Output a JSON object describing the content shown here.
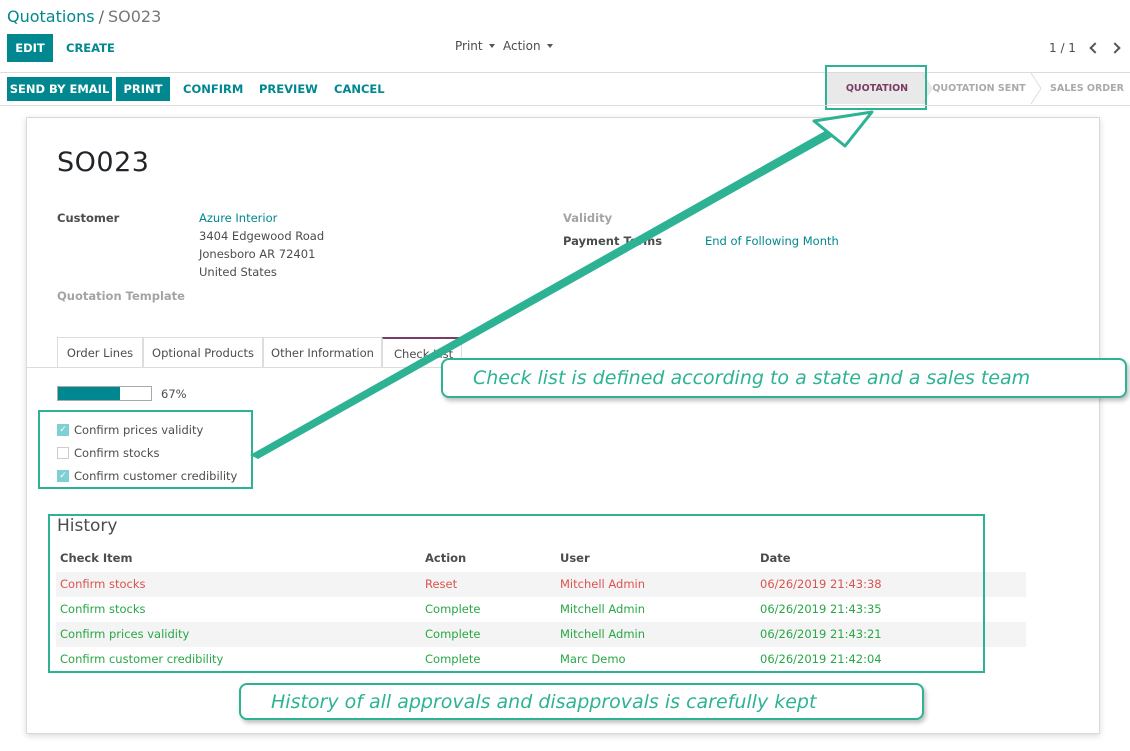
{
  "breadcrumb": {
    "parent": "Quotations",
    "current": "SO023"
  },
  "buttons": {
    "edit": "EDIT",
    "create": "CREATE"
  },
  "dropdowns": {
    "print": "Print",
    "action": "Action"
  },
  "pager": {
    "value": "1 / 1"
  },
  "header_buttons": {
    "send_email": "SEND BY EMAIL",
    "print": "PRINT",
    "confirm": "CONFIRM",
    "preview": "PREVIEW",
    "cancel": "CANCEL"
  },
  "stages": [
    "QUOTATION",
    "QUOTATION SENT",
    "SALES ORDER"
  ],
  "form": {
    "title": "SO023",
    "customer_label": "Customer",
    "customer_name": "Azure Interior",
    "address_line1": "3404 Edgewood Road",
    "address_line2": "Jonesboro AR 72401",
    "address_line3": "United States",
    "quotation_template_label": "Quotation Template",
    "validity_label": "Validity",
    "payment_terms_label": "Payment Terms",
    "payment_terms_value": "End of Following Month"
  },
  "tabs": [
    "Order Lines",
    "Optional Products",
    "Other Information",
    "Check List"
  ],
  "progress": {
    "percent": 67,
    "label": "67%"
  },
  "checklist": [
    {
      "label": "Confirm prices validity",
      "checked": true
    },
    {
      "label": "Confirm stocks",
      "checked": false
    },
    {
      "label": "Confirm customer credibility",
      "checked": true
    }
  ],
  "history": {
    "title": "History",
    "columns": [
      "Check Item",
      "Action",
      "User",
      "Date"
    ],
    "rows": [
      {
        "item": "Confirm stocks",
        "action": "Reset",
        "user": "Mitchell Admin",
        "date": "06/26/2019 21:43:38",
        "status": "reset"
      },
      {
        "item": "Confirm stocks",
        "action": "Complete",
        "user": "Mitchell Admin",
        "date": "06/26/2019 21:43:35",
        "status": "complete"
      },
      {
        "item": "Confirm prices validity",
        "action": "Complete",
        "user": "Mitchell Admin",
        "date": "06/26/2019 21:43:21",
        "status": "complete"
      },
      {
        "item": "Confirm customer credibility",
        "action": "Complete",
        "user": "Marc Demo",
        "date": "06/26/2019 21:42:04",
        "status": "complete"
      }
    ]
  },
  "annotations": {
    "checklist_note": "Check list is defined according to a state and a sales team",
    "history_note": "History of all approvals and disapprovals is carefully kept"
  },
  "colors": {
    "primary": "#00878f",
    "accent": "#7a3c64",
    "callout": "#2db394",
    "reset": "#d9534f",
    "complete": "#28a745"
  }
}
